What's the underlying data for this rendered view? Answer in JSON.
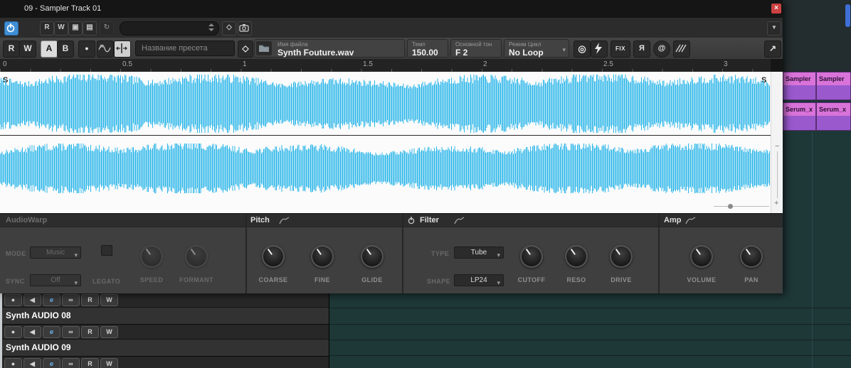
{
  "colors": {
    "wave": "#29b6e9",
    "accent_blue": "#3f8fd6",
    "clip_header": "#d973d9",
    "clip_body": "#9a5ace",
    "close_red": "#cc4141",
    "grid_teal": "#1e3737"
  },
  "titlebar": {
    "title": "09 - Sampler Track 01",
    "close_glyph": "×"
  },
  "icons": {
    "chevron_down": "▾",
    "diamond": "◇",
    "target": "◎",
    "at": "@",
    "expand": "↗",
    "refresh": "↻",
    "record": "●",
    "minus": "−",
    "plus": "+",
    "grid_box": "▣",
    "lines_box": "▤",
    "dropdown_arrow": "▼"
  },
  "toolbar_top": {
    "read": "R",
    "write": "W"
  },
  "toolbar": {
    "read": "R",
    "write": "W",
    "a": "A",
    "b": "B",
    "preset_placeholder": "Название пресета",
    "file_label": "Имя файла",
    "file_name": "Synth Fouture.wav",
    "tempo_label": "Темп",
    "tempo_value": "150.00",
    "key_label": "Основной тон",
    "key_value": "F 2",
    "loop_label": "Режим Цикл",
    "loop_value": "No Loop",
    "fix_label": "FIX",
    "flip_label": "Я"
  },
  "ruler": {
    "ticks": [
      "0",
      "0.5",
      "1",
      "1.5",
      "2",
      "2.5",
      "3"
    ]
  },
  "waveform": {
    "marker_left": "S",
    "marker_right": "S"
  },
  "panels": {
    "audiowarp": {
      "title": "AudioWarp",
      "mode_label": "MODE",
      "mode_value": "Music",
      "sync_label": "SYNC",
      "sync_value": "Off",
      "legato_label": "LEGATO",
      "knobs": [
        "SPEED",
        "FORMANT"
      ]
    },
    "pitch": {
      "title": "Pitch",
      "knobs": [
        "COARSE",
        "FINE",
        "GLIDE"
      ]
    },
    "filter": {
      "title": "Filter",
      "type_label": "TYPE",
      "type_value": "Tube",
      "shape_label": "SHAPE",
      "shape_value": "LP24",
      "knobs": [
        "CUTOFF",
        "RESO",
        "DRIVE"
      ]
    },
    "amp": {
      "title": "Amp",
      "knobs": [
        "VOLUME",
        "PAN"
      ]
    }
  },
  "project": {
    "tracks": [
      {
        "name": "Synth AUDIO 08"
      },
      {
        "name": "Synth AUDIO 09"
      }
    ],
    "track_buttons": [
      "●",
      "◀",
      "e",
      "∞",
      "R",
      "W"
    ],
    "clips": [
      {
        "label": "Sampler"
      },
      {
        "label": "Sampler"
      },
      {
        "label": "Serum_x"
      },
      {
        "label": "Serum_x"
      }
    ]
  }
}
